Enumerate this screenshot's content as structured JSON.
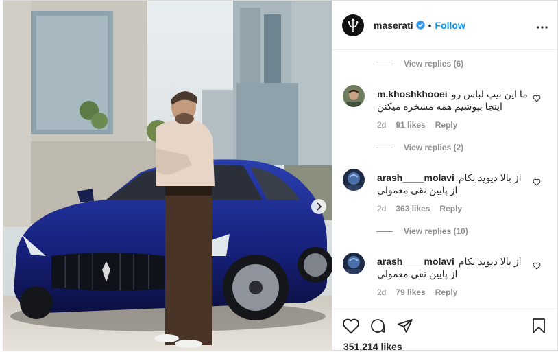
{
  "header": {
    "username": "maserati",
    "separator": "•",
    "follow_label": "Follow",
    "more_label": "•••"
  },
  "comments": {
    "view_replies": [
      "View replies (6)",
      "View replies (2)",
      "View replies (10)"
    ],
    "items": [
      {
        "user": "m.khoshkhooei",
        "line1": "ما این تیپ لباس رو",
        "line2": "اینجا بپوشیم همه مسخره میکنن",
        "age": "2d",
        "likes": "91 likes",
        "reply": "Reply"
      },
      {
        "user": "arash____molavi",
        "line1": "از بالا دیوید بکام",
        "line2": "از پایین نقی معمولی",
        "age": "2d",
        "likes": "363 likes",
        "reply": "Reply"
      },
      {
        "user": "arash____molavi",
        "line1": "از بالا دیوید بکام",
        "line2": "از پایین نقی معمولی",
        "age": "2d",
        "likes": "79 likes",
        "reply": "Reply"
      }
    ]
  },
  "footer": {
    "likes_count": "351,214 likes"
  },
  "icons": {
    "verified": "verified-badge-icon",
    "heart": "heart-icon",
    "comment": "comment-icon",
    "share": "share-icon",
    "save": "bookmark-icon",
    "next": "chevron-right-icon"
  },
  "colors": {
    "accent": "#0095f6",
    "car": "#1c2c8c",
    "muted": "#8e8e8e"
  }
}
